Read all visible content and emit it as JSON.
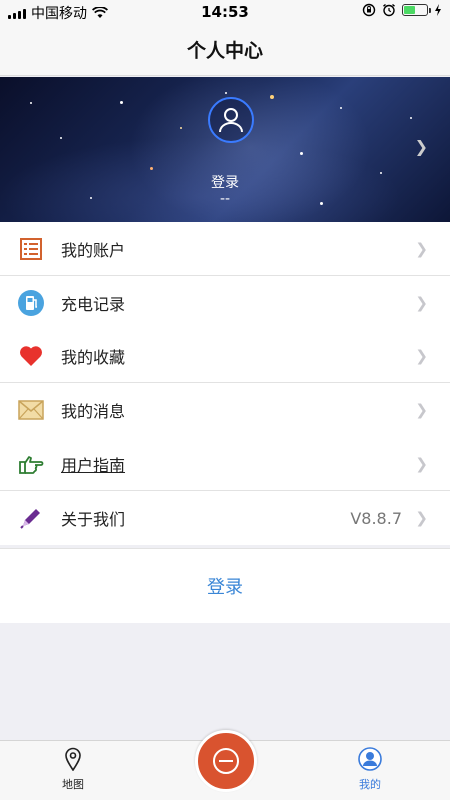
{
  "status_bar": {
    "carrier": "中国移动",
    "time": "14:53"
  },
  "nav": {
    "title": "个人中心"
  },
  "profile": {
    "login_label": "登录",
    "sub_label": "--"
  },
  "menu_groups": [
    {
      "items": [
        {
          "label": "我的账户",
          "icon": "ledger-icon"
        },
        {
          "label": "充电记录",
          "icon": "charging-station-icon"
        }
      ]
    },
    {
      "items": [
        {
          "label": "我的收藏",
          "icon": "heart-icon"
        },
        {
          "label": "我的消息",
          "icon": "envelope-icon"
        }
      ]
    },
    {
      "items": [
        {
          "label": "用户指南",
          "icon": "pointing-hand-icon"
        },
        {
          "label": "关于我们",
          "icon": "pencil-icon",
          "value": "V8.8.7"
        }
      ]
    }
  ],
  "login_button": "登录",
  "tabs": [
    {
      "label": "地图",
      "icon": "map-pin-icon",
      "active": false
    },
    {
      "label": "我的",
      "icon": "user-icon",
      "active": true
    }
  ],
  "colors": {
    "accent_blue": "#3a86d6",
    "center_button": "#d9532f",
    "heart": "#e8322d",
    "pencil": "#6a2c91"
  }
}
